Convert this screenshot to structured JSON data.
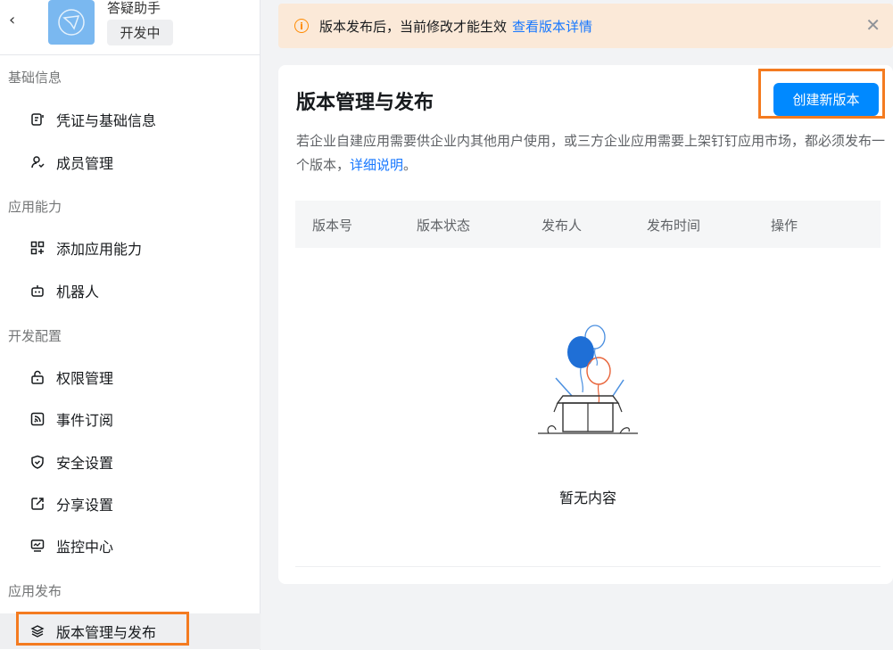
{
  "app": {
    "name": "答疑助手",
    "status": "开发中"
  },
  "sidebar": {
    "sections": [
      {
        "title": "基础信息",
        "items": [
          {
            "label": "凭证与基础信息",
            "icon": "credential-icon"
          },
          {
            "label": "成员管理",
            "icon": "member-icon"
          }
        ]
      },
      {
        "title": "应用能力",
        "items": [
          {
            "label": "添加应用能力",
            "icon": "add-capability-icon"
          },
          {
            "label": "机器人",
            "icon": "robot-icon"
          }
        ]
      },
      {
        "title": "开发配置",
        "items": [
          {
            "label": "权限管理",
            "icon": "lock-icon"
          },
          {
            "label": "事件订阅",
            "icon": "rss-icon"
          },
          {
            "label": "安全设置",
            "icon": "shield-icon"
          },
          {
            "label": "分享设置",
            "icon": "share-icon"
          },
          {
            "label": "监控中心",
            "icon": "monitor-icon"
          }
        ]
      },
      {
        "title": "应用发布",
        "items": [
          {
            "label": "版本管理与发布",
            "icon": "layers-icon",
            "active": true
          }
        ]
      }
    ]
  },
  "notice": {
    "text": "版本发布后，当前修改才能生效",
    "link": "查看版本详情"
  },
  "main": {
    "title": "版本管理与发布",
    "create_button": "创建新版本",
    "description": "若企业自建应用需要供企业内其他用户使用，或三方企业应用需要上架钉钉应用市场，都必须发布一个版本，",
    "description_link": "详细说明",
    "description_end": "。",
    "table": {
      "columns": [
        "版本号",
        "版本状态",
        "发布人",
        "发布时间",
        "操作"
      ]
    },
    "empty_text": "暂无内容"
  },
  "colors": {
    "primary": "#0089ff",
    "link": "#1677ff",
    "notice_bg": "#fbe9d8",
    "highlight": "#f47b20"
  }
}
